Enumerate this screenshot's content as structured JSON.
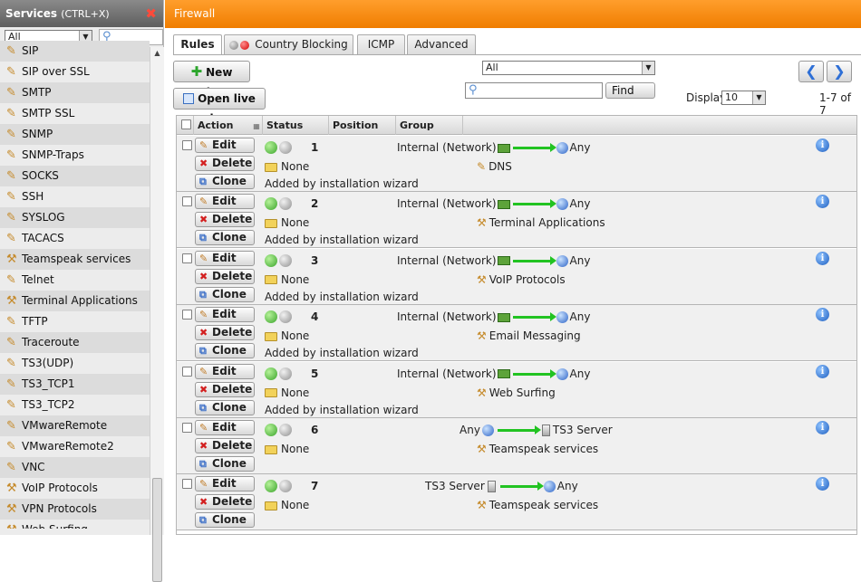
{
  "left_panel": {
    "title": "Services",
    "shortcut": "(CTRL+X)",
    "filter_value": "All",
    "services": [
      {
        "label": "SIP",
        "icon": "pen-icon"
      },
      {
        "label": "SIP over SSL",
        "icon": "pen-icon"
      },
      {
        "label": "SMTP",
        "icon": "pen-icon"
      },
      {
        "label": "SMTP SSL",
        "icon": "pen-icon"
      },
      {
        "label": "SNMP",
        "icon": "pen-icon"
      },
      {
        "label": "SNMP-Traps",
        "icon": "pen-icon"
      },
      {
        "label": "SOCKS",
        "icon": "pen-icon"
      },
      {
        "label": "SSH",
        "icon": "pen-icon"
      },
      {
        "label": "SYSLOG",
        "icon": "pen-icon"
      },
      {
        "label": "TACACS",
        "icon": "pen-icon"
      },
      {
        "label": "Teamspeak services",
        "icon": "group-icon"
      },
      {
        "label": "Telnet",
        "icon": "pen-icon"
      },
      {
        "label": "Terminal Applications",
        "icon": "group-icon"
      },
      {
        "label": "TFTP",
        "icon": "pen-icon"
      },
      {
        "label": "Traceroute",
        "icon": "pen-icon"
      },
      {
        "label": "TS3(UDP)",
        "icon": "pen-icon"
      },
      {
        "label": "TS3_TCP1",
        "icon": "pen-icon"
      },
      {
        "label": "TS3_TCP2",
        "icon": "pen-icon"
      },
      {
        "label": "VMwareRemote",
        "icon": "pen-icon"
      },
      {
        "label": "VMwareRemote2",
        "icon": "pen-icon"
      },
      {
        "label": "VNC",
        "icon": "pen-icon"
      },
      {
        "label": "VoIP Protocols",
        "icon": "group-icon"
      },
      {
        "label": "VPN Protocols",
        "icon": "group-icon"
      },
      {
        "label": "Web Surfing",
        "icon": "group-icon"
      }
    ]
  },
  "main": {
    "title": "Firewall",
    "tabs": [
      "Rules",
      "Country Blocking",
      "ICMP",
      "Advanced"
    ],
    "new_rule_label": "New rule...",
    "live_log_label": "Open live log",
    "group_filter": "All",
    "search_placeholder": "",
    "find_label": "Find",
    "display_label": "Display:",
    "display_value": "10",
    "page_count": "1-7 of 7",
    "columns": [
      "Action",
      "Status",
      "Position",
      "Group"
    ],
    "buttons": {
      "edit": "Edit",
      "delete": "Delete",
      "clone": "Clone"
    },
    "rules": [
      {
        "position": "1",
        "group": "None",
        "comment": "Added by installation wizard",
        "source": "Internal (Network)",
        "source_icon": "network-icon",
        "destination": "Any",
        "destination_icon": "globe-icon",
        "service": "DNS",
        "service_icon": "pen-icon",
        "status": "on"
      },
      {
        "position": "2",
        "group": "None",
        "comment": "Added by installation wizard",
        "source": "Internal (Network)",
        "source_icon": "network-icon",
        "destination": "Any",
        "destination_icon": "globe-icon",
        "service": "Terminal Applications",
        "service_icon": "group-icon",
        "status": "on"
      },
      {
        "position": "3",
        "group": "None",
        "comment": "Added by installation wizard",
        "source": "Internal (Network)",
        "source_icon": "network-icon",
        "destination": "Any",
        "destination_icon": "globe-icon",
        "service": "VoIP Protocols",
        "service_icon": "group-icon",
        "status": "on"
      },
      {
        "position": "4",
        "group": "None",
        "comment": "Added by installation wizard",
        "source": "Internal (Network)",
        "source_icon": "network-icon",
        "destination": "Any",
        "destination_icon": "globe-icon",
        "service": "Email Messaging",
        "service_icon": "group-icon",
        "status": "on"
      },
      {
        "position": "5",
        "group": "None",
        "comment": "Added by installation wizard",
        "source": "Internal (Network)",
        "source_icon": "network-icon",
        "destination": "Any",
        "destination_icon": "globe-icon",
        "service": "Web Surfing",
        "service_icon": "group-icon",
        "status": "on"
      },
      {
        "position": "6",
        "group": "None",
        "comment": "",
        "source": "Any",
        "source_icon": "globe-icon",
        "destination": "TS3 Server",
        "destination_icon": "server-icon",
        "service": "Teamspeak services",
        "service_icon": "group-icon",
        "status": "on"
      },
      {
        "position": "7",
        "group": "None",
        "comment": "",
        "source": "TS3 Server",
        "source_icon": "server-icon",
        "destination": "Any",
        "destination_icon": "globe-icon",
        "service": "Teamspeak services",
        "service_icon": "group-icon",
        "status": "on"
      }
    ]
  },
  "colors": {
    "header_orange": "#f07d00",
    "accent_green": "#22c322",
    "info_blue": "#1f5fc0"
  }
}
